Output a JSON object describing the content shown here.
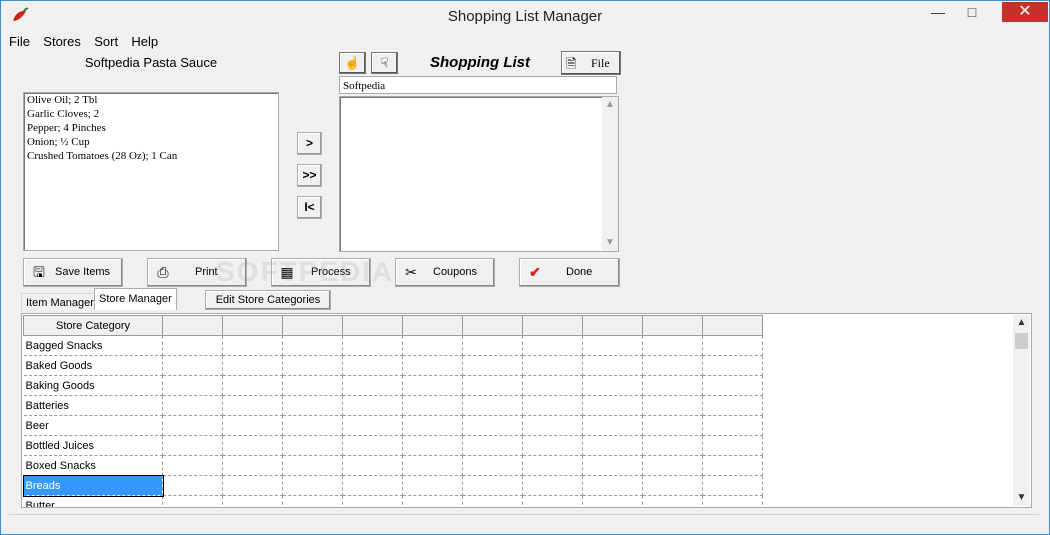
{
  "window": {
    "title": "Shopping List Manager",
    "minimize": "—",
    "maximize": "□",
    "close": "✕",
    "accent": "#c7302b"
  },
  "menu": [
    {
      "label": "File"
    },
    {
      "label": "Stores"
    },
    {
      "label": "Sort"
    },
    {
      "label": "Help"
    }
  ],
  "recipe": {
    "title": "Softpedia Pasta Sauce",
    "items": [
      "Olive Oil; 2 Tbl",
      "Garlic Cloves; 2",
      "Pepper; 4 Pinches",
      "Onion; ½ Cup",
      "Crushed Tomatoes (28 Oz); 1 Can"
    ]
  },
  "transfer": {
    "add_one": ">",
    "add_all": ">>",
    "clear": "I<"
  },
  "shopping": {
    "title": "Shopping List",
    "file_label": "File",
    "store_name": "Softpedia",
    "items": []
  },
  "actions": {
    "save": "Save Items",
    "print": "Print",
    "process": "Process",
    "coupons": "Coupons",
    "done": "Done"
  },
  "tabs": {
    "item_manager": "Item Manager",
    "store_manager": "Store Manager",
    "edit_categories": "Edit Store Categories"
  },
  "grid": {
    "header": "Store Category",
    "rows": [
      "Bagged Snacks",
      "Baked Goods",
      "Baking Goods",
      "Batteries",
      "Beer",
      "Bottled Juices",
      "Boxed Snacks",
      "Breads",
      "Butter"
    ],
    "selected": "Breads",
    "selection_color": "#3399ff"
  },
  "watermark": "SOFTPEDIA"
}
